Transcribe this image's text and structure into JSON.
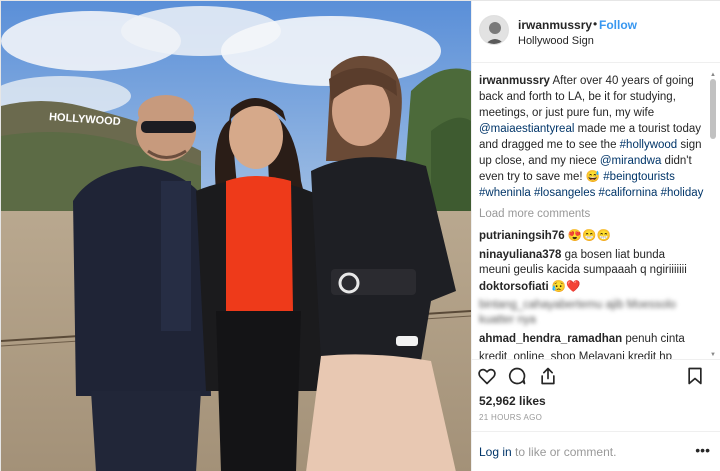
{
  "post": {
    "username": "irwanmussry",
    "separator": "•",
    "follow_label": "Follow",
    "location": "Hollywood Sign",
    "image_sign_text": "HOLLYWOOD",
    "caption": {
      "author": "irwanmussry",
      "p1": " After over 40 years of going back and forth to LA, be it for studying, meetings, or just pure fun, my wife ",
      "mention1": "@maiaestiantyreal",
      "p2": " made me a tourist today and dragged me to see the ",
      "hashtag1": "#hollywood",
      "p3": " sign up close, and my niece ",
      "mention2": "@mirandwa",
      "p4": " didn't even try to save me! ",
      "emoji": "😅",
      "p5": " ",
      "tags": "#beingtourists #wheninla #losangeles #californina #holiday"
    },
    "load_more": "Load more comments",
    "comments": [
      {
        "user": "putrianingsih76",
        "text": " 😍😁😁"
      },
      {
        "user": "ninayuliana378",
        "text": " ga bosen liat bunda"
      },
      {
        "user": "",
        "text": "meuni geulis kacida sumpaaah q ngiriiiiiii"
      },
      {
        "user": "doktorsofiati",
        "text": " 😥❤️"
      },
      {
        "user": "",
        "text": "bintang_cahayabertemu ajib Moessolo"
      },
      {
        "user": "",
        "text": "kuatter nya"
      },
      {
        "user": "ahmad_hendra_ramadhan",
        "text": " penuh cinta"
      },
      {
        "user": "",
        "text": "kredit_online_shop Melayani kredit hp"
      }
    ],
    "likes": "52,962 likes",
    "time": "21 HOURS AGO",
    "login_link": "Log in",
    "login_rest": " to like or comment.",
    "more_label": "•••"
  },
  "colors": {
    "link": "#003569",
    "follow": "#3897f0",
    "muted": "#999999",
    "sweater": "#ee3a1a"
  },
  "icons": {
    "like": "heart-icon",
    "comment": "comment-bubble-icon",
    "share": "share-icon",
    "save": "bookmark-icon",
    "more": "more-options-icon"
  }
}
